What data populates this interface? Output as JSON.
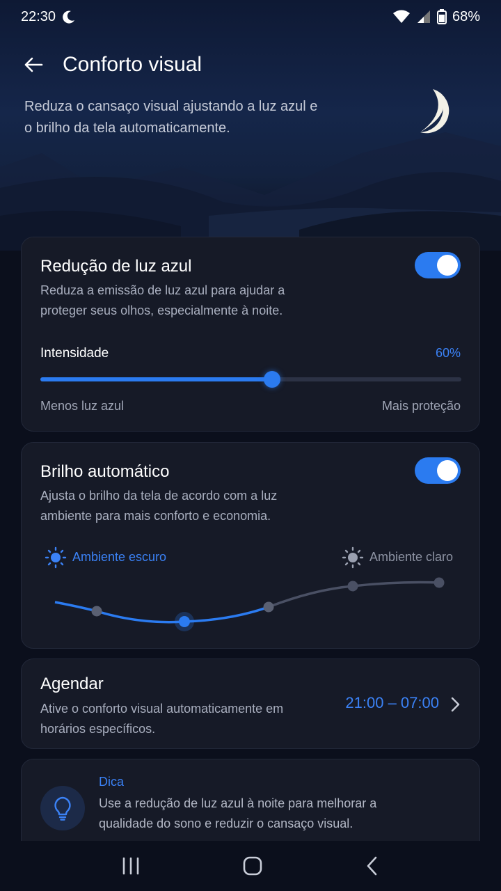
{
  "status_bar": {
    "time": "22:30",
    "battery": "68%"
  },
  "header": {
    "title": "Conforto visual",
    "subtitle": "Reduza o cansaço visual ajustando a luz azul e o brilho da tela automaticamente."
  },
  "blue_light": {
    "title": "Redução de luz azul",
    "description": "Reduza a emissão de luz azul para ajudar a proteger seus olhos, especialmente à noite.",
    "enabled": true,
    "intensity_label": "Intensidade",
    "intensity_value": "60%",
    "intensity_fraction": 0.55,
    "min_label": "Menos luz azul",
    "max_label": "Mais proteção"
  },
  "auto_brightness": {
    "title": "Brilho automático",
    "description": "Ajusta o brilho da tela de acordo com a luz ambiente para mais conforto e economia.",
    "enabled": true,
    "dark_label": "Ambiente escuro",
    "light_label": "Ambiente claro"
  },
  "schedule": {
    "title": "Agendar",
    "description": "Ative o conforto visual automaticamente em horários específicos.",
    "time_range": "21:00 – 07:00"
  },
  "tip": {
    "title": "Dica",
    "text": "Use a redução de luz azul à noite para melhorar a qualidade do sono e reduzir o cansaço visual."
  },
  "colors": {
    "accent": "#2b7bf0",
    "background": "#0b0f1c",
    "card": "#161a27"
  },
  "icons": [
    "moon-icon",
    "wifi-icon",
    "signal-icon",
    "battery-icon",
    "back-arrow-icon",
    "sun-icon",
    "chevron-right-icon",
    "lightbulb-icon",
    "recents-icon",
    "home-icon",
    "nav-back-icon"
  ]
}
